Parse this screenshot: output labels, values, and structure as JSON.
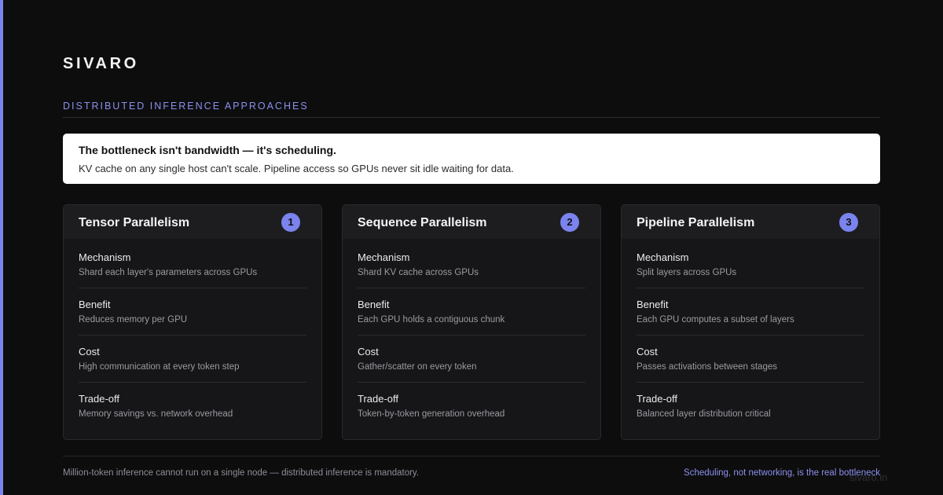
{
  "brand": "SIVARO",
  "section_label": "DISTRIBUTED INFERENCE APPROACHES",
  "callout": {
    "title": "The bottleneck isn't bandwidth — it's scheduling.",
    "body": "KV cache on any single host can't scale. Pipeline access so GPUs never sit idle waiting for data."
  },
  "cards": [
    {
      "title": "Tensor Parallelism",
      "number": "1",
      "rows": [
        {
          "label": "Mechanism",
          "value": "Shard each layer's parameters across GPUs"
        },
        {
          "label": "Benefit",
          "value": "Reduces memory per GPU"
        },
        {
          "label": "Cost",
          "value": "High communication at every token step"
        },
        {
          "label": "Trade-off",
          "value": "Memory savings vs. network overhead"
        }
      ]
    },
    {
      "title": "Sequence Parallelism",
      "number": "2",
      "rows": [
        {
          "label": "Mechanism",
          "value": "Shard KV cache across GPUs"
        },
        {
          "label": "Benefit",
          "value": "Each GPU holds a contiguous chunk"
        },
        {
          "label": "Cost",
          "value": "Gather/scatter on every token"
        },
        {
          "label": "Trade-off",
          "value": "Token-by-token generation overhead"
        }
      ]
    },
    {
      "title": "Pipeline Parallelism",
      "number": "3",
      "rows": [
        {
          "label": "Mechanism",
          "value": "Split layers across GPUs"
        },
        {
          "label": "Benefit",
          "value": "Each GPU computes a subset of layers"
        },
        {
          "label": "Cost",
          "value": "Passes activations between stages"
        },
        {
          "label": "Trade-off",
          "value": "Balanced layer distribution critical"
        }
      ]
    }
  ],
  "footer": {
    "left": "Million-token inference cannot run on a single node — distributed inference is mandatory.",
    "right": "Scheduling, not networking, is the real bottleneck"
  },
  "watermark": "sivaro.in",
  "colors": {
    "background": "#0d0d0e",
    "accent": "#7b83ee",
    "card": "#161618",
    "callout": "#ffffff"
  }
}
